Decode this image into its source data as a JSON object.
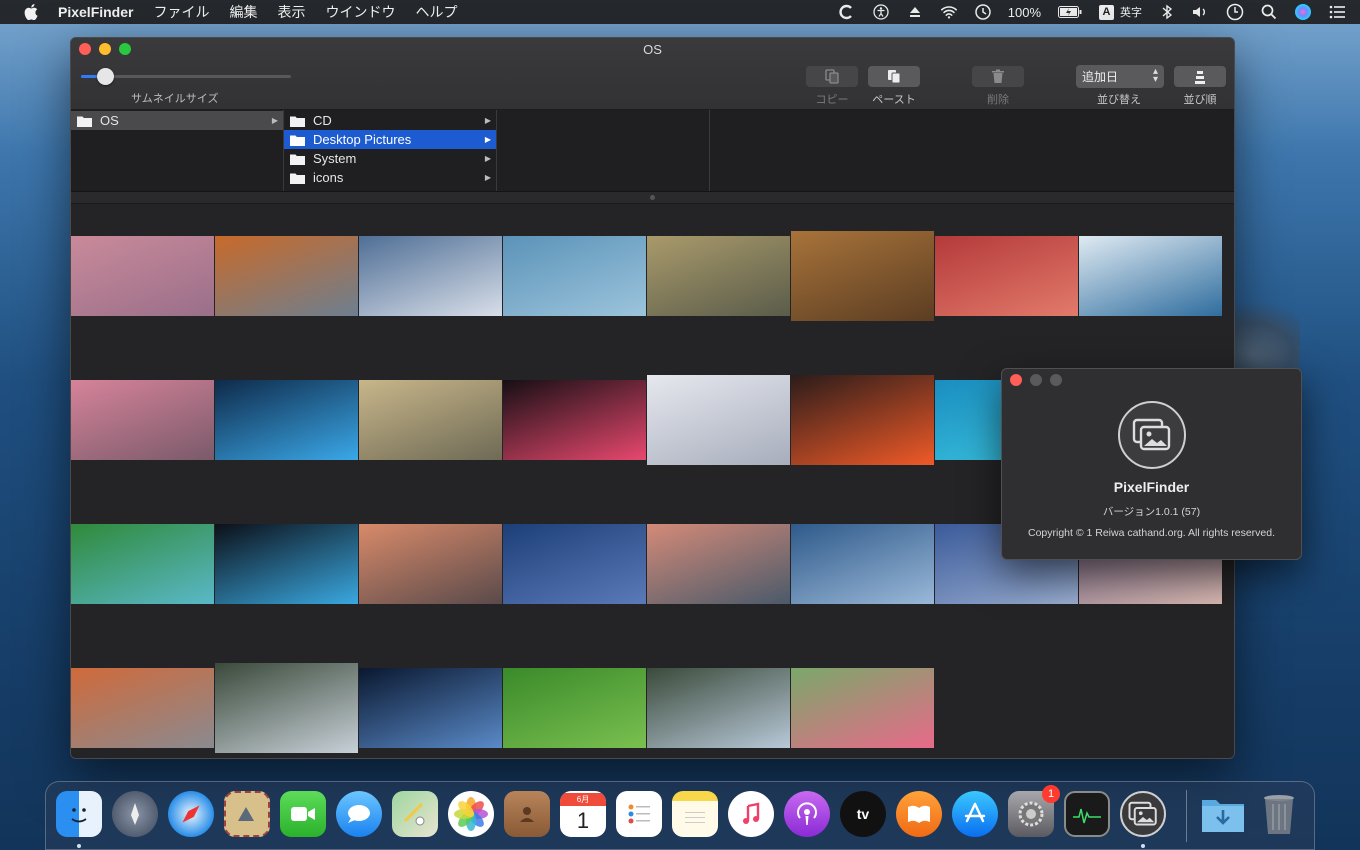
{
  "menubar": {
    "app_name": "PixelFinder",
    "items": [
      "ファイル",
      "編集",
      "表示",
      "ウインドウ",
      "ヘルプ"
    ],
    "battery": "100%",
    "input_mode_badge": "A",
    "input_mode": "英字"
  },
  "window": {
    "title": "OS",
    "thumbnail_size_label": "サムネイルサイズ",
    "thumbnail_size_level": 0.08,
    "toolbar": {
      "copy": "コピー",
      "paste": "ペースト",
      "delete": "削除",
      "sort_value": "追加日",
      "sort_label": "並び替え",
      "order_label": "並び順"
    }
  },
  "browser": {
    "column1": [
      {
        "name": "OS"
      }
    ],
    "column2": [
      {
        "name": "CD"
      },
      {
        "name": "Desktop Pictures"
      },
      {
        "name": "System"
      },
      {
        "name": "icons"
      }
    ]
  },
  "thumbnails": [
    [
      "#c98a9a",
      "#9a6f8a"
    ],
    [
      "#c86a2a",
      "#6d7f90"
    ],
    [
      "#4f6f96",
      "#d8dee8"
    ],
    [
      "#5b93b8",
      "#9cc4dc"
    ],
    [
      "#a99a6b",
      "#5a5c4a"
    ],
    [
      "#a8733a",
      "#5b3d22"
    ],
    [
      "#b43a3a",
      "#e27a6b"
    ],
    [
      "#dfeaf2",
      "#2f6d9e"
    ],
    [
      "#d6839a",
      "#7a5a6a"
    ],
    [
      "#0f2a4a",
      "#3aa8e8"
    ],
    [
      "#c8b68a",
      "#6e6a55"
    ],
    [
      "#160f14",
      "#e8486e"
    ],
    [
      "#e6e8ee",
      "#a7adbc"
    ],
    [
      "#2b1c1a",
      "#f05a28"
    ],
    [
      "#1a8dc0",
      "#3cc6e0"
    ],
    [
      "#101018",
      "#c240c8"
    ],
    [
      "#2f8a3a",
      "#5ab8c8"
    ],
    [
      "#0c1018",
      "#3aa8e0"
    ],
    [
      "#d88a6a",
      "#5a4a4a"
    ],
    [
      "#1d3f78",
      "#5a7ab8"
    ],
    [
      "#d48a78",
      "#4a5a6a"
    ],
    [
      "#2f5a8a",
      "#9ab8d8"
    ],
    [
      "#3a5a9a",
      "#9aaed0"
    ],
    [
      "#7a6a8a",
      "#d8b8b0"
    ],
    [
      "#d06a3a",
      "#8a8a90"
    ],
    [
      "#3a4a3a",
      "#c8d0d8"
    ],
    [
      "#0a1830",
      "#5a8ac8"
    ],
    [
      "#3a8a2a",
      "#7ac050"
    ],
    [
      "#3a4a3a",
      "#b8c8d8"
    ],
    [
      "#7aa86a",
      "#e86a8a"
    ]
  ],
  "about": {
    "app_name": "PixelFinder",
    "version": "バージョン1.0.1 (57)",
    "copyright": "Copyright © 1 Reiwa cathand.org. All rights reserved."
  },
  "dock": {
    "items": [
      "finder-icon",
      "launchpad-icon",
      "safari-icon",
      "mail-icon",
      "facetime-icon",
      "messages-icon",
      "maps-icon",
      "photos-icon",
      "contacts-icon",
      "calendar-icon",
      "reminders-icon",
      "notes-icon",
      "music-icon",
      "podcasts-icon",
      "tv-icon",
      "books-icon",
      "app-store-icon",
      "system-preferences-icon",
      "activity-monitor-icon",
      "pixelfinder-icon",
      "downloads-folder-icon",
      "trash-icon"
    ],
    "calendar_month": "6月",
    "calendar_day": "1",
    "tv_label": "tv",
    "sysprefs_badge": "1"
  },
  "colors": {
    "accent": "#1c5bd0",
    "close": "#ff5f57",
    "minimize": "#febc2e",
    "maximize": "#28c840"
  }
}
